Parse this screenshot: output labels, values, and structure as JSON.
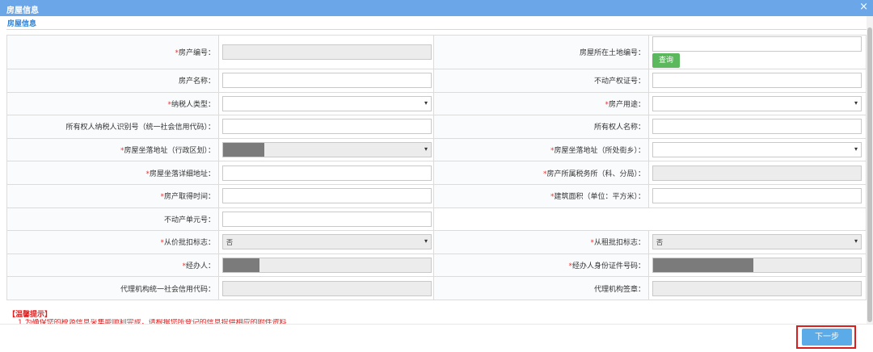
{
  "window": {
    "title": "房屋信息",
    "close_icon": "×"
  },
  "section": {
    "title": "房屋信息"
  },
  "fields": {
    "property_no": {
      "label": "房产编号：",
      "required": "*"
    },
    "land_no": {
      "label": "房屋所在土地编号：",
      "query_label": "查询"
    },
    "property_name": {
      "label": "房产名称："
    },
    "cert_no": {
      "label": "不动产权证号："
    },
    "taxpayer_type": {
      "label": "纳税人类型：",
      "required": "*"
    },
    "usage": {
      "label": "房产用途：",
      "required": "*"
    },
    "owner_taxid": {
      "label": "所有权人纳税人识别号（统一社会信用代码）："
    },
    "owner_name": {
      "label": "所有权人名称："
    },
    "district": {
      "label": "房屋坐落地址（行政区划）：",
      "required": "*"
    },
    "street": {
      "label": "房屋坐落地址（所处街乡）：",
      "required": "*"
    },
    "detail_addr": {
      "label": "房屋坐落详细地址：",
      "required": "*"
    },
    "tax_office": {
      "label": "房产所属税务所（科、分局）：",
      "required": "*"
    },
    "acquire_time": {
      "label": "房产取得时间：",
      "required": "*"
    },
    "area": {
      "label": "建筑面积（单位：平方米）：",
      "required": "*"
    },
    "unit_no": {
      "label": "不动产单元号："
    },
    "value_flag": {
      "label": "从价批扣标志：",
      "required": "*",
      "value": "否"
    },
    "rent_flag": {
      "label": "从租批扣标志：",
      "required": "*",
      "value": "否"
    },
    "handler": {
      "label": "经办人：",
      "required": "*"
    },
    "handler_id": {
      "label": "经办人身份证件号码：",
      "required": "*"
    },
    "agency_code": {
      "label": "代理机构统一社会信用代码："
    },
    "agency_sign": {
      "label": "代理机构签章："
    }
  },
  "tips": {
    "title": "【温馨提示】",
    "text": "1.为确保您的税源信息采集能顺利完成，请根据您所登记的信息提供相应的附件资料"
  },
  "footer": {
    "next_label": "下一步"
  },
  "colors": {
    "titlebar": "#6aa6e8",
    "required": "#e33333",
    "query_button": "#5cb85c",
    "next_button": "#5aabe8",
    "highlight_outline": "#d81e1e"
  },
  "icons": {
    "dropdown": "chevron-down-icon",
    "close": "close-icon"
  }
}
